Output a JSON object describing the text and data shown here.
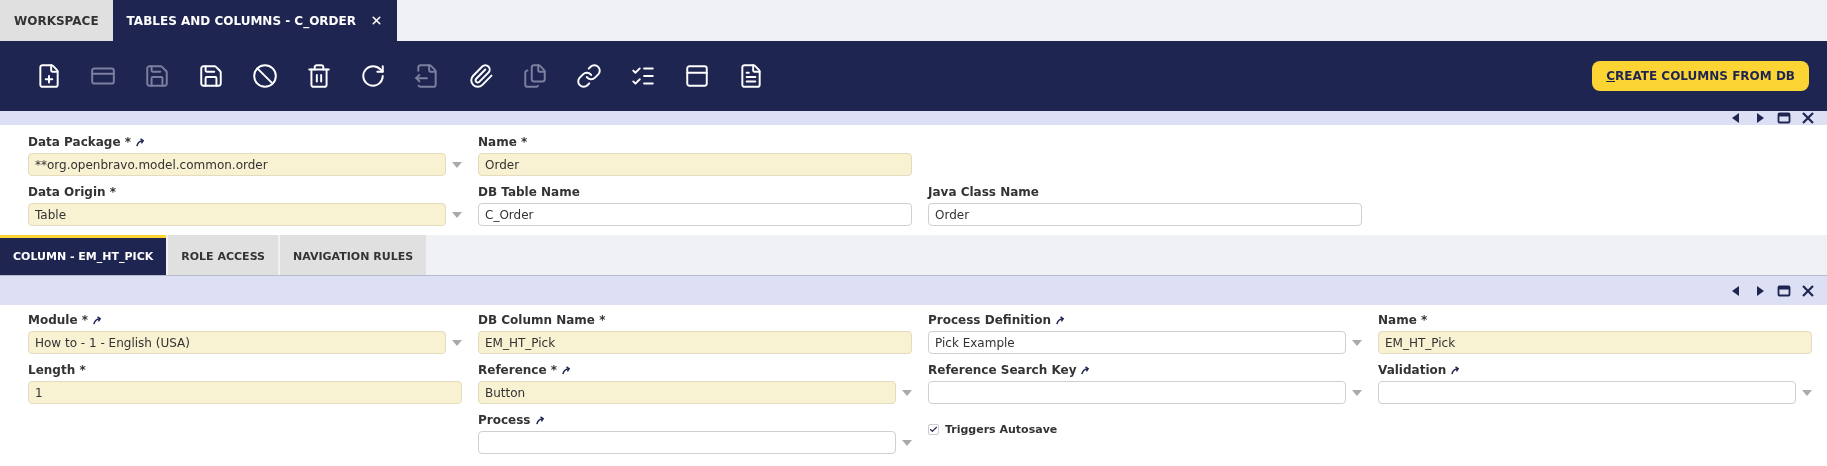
{
  "tabs": [
    {
      "label": "WORKSPACE",
      "selected": false,
      "closable": false
    },
    {
      "label": "TABLES AND COLUMNS - C_ORDER",
      "selected": true,
      "closable": true
    }
  ],
  "toolbar": {
    "buttons": [
      {
        "kind": "new-document",
        "disabled": false
      },
      {
        "kind": "new-row",
        "disabled": true
      },
      {
        "kind": "save",
        "disabled": true
      },
      {
        "kind": "save-close",
        "disabled": false
      },
      {
        "kind": "cancel",
        "disabled": false
      },
      {
        "kind": "delete",
        "disabled": false
      },
      {
        "kind": "refresh",
        "disabled": false
      },
      {
        "kind": "export",
        "disabled": true
      },
      {
        "kind": "attach",
        "disabled": false
      },
      {
        "kind": "copy",
        "disabled": true
      },
      {
        "kind": "link",
        "disabled": false
      },
      {
        "kind": "tools",
        "disabled": false
      },
      {
        "kind": "grid",
        "disabled": false
      },
      {
        "kind": "notes",
        "disabled": false
      }
    ],
    "action": "CREATE COLUMNS FROM DB"
  },
  "header_form": {
    "rows": [
      {
        "offset": false,
        "fields": [
          {
            "kind": "combo",
            "label": "Data Package *",
            "linked": true,
            "required": true,
            "value": "**org.openbravo.model.common.order"
          },
          {
            "kind": "text",
            "label": "Name *",
            "linked": false,
            "required": true,
            "value": "Order"
          }
        ]
      },
      {
        "offset": false,
        "fields": [
          {
            "kind": "combo",
            "label": "Data Origin *",
            "linked": false,
            "required": true,
            "value": "Table"
          },
          {
            "kind": "text",
            "label": "DB Table Name",
            "linked": false,
            "required": false,
            "value": "C_Order"
          },
          {
            "kind": "text",
            "label": "Java Class Name",
            "linked": false,
            "required": false,
            "value": "Order"
          }
        ]
      }
    ]
  },
  "subtabs": [
    {
      "label": "COLUMN - EM_HT_PICK",
      "selected": true
    },
    {
      "label": "ROLE ACCESS",
      "selected": false
    },
    {
      "label": "NAVIGATION RULES",
      "selected": false
    }
  ],
  "detail_form": {
    "rows": [
      {
        "offset": false,
        "fields": [
          {
            "kind": "combo",
            "label": "Module *",
            "linked": true,
            "required": true,
            "value": "How to - 1 - English (USA)"
          },
          {
            "kind": "text",
            "label": "DB Column Name *",
            "linked": false,
            "required": true,
            "value": "EM_HT_Pick"
          },
          {
            "kind": "combo",
            "label": "Process Definition",
            "linked": true,
            "required": false,
            "value": "Pick Example"
          },
          {
            "kind": "text",
            "label": "Name *",
            "linked": false,
            "required": true,
            "value": "EM_HT_Pick"
          }
        ]
      },
      {
        "offset": false,
        "fields": [
          {
            "kind": "text",
            "label": "Length *",
            "linked": false,
            "required": true,
            "value": "1"
          },
          {
            "kind": "combo",
            "label": "Reference *",
            "linked": true,
            "required": true,
            "value": "Button"
          },
          {
            "kind": "combo",
            "label": "Reference Search Key",
            "linked": true,
            "required": false
          },
          {
            "kind": "combo",
            "label": "Validation",
            "linked": true,
            "required": false
          }
        ]
      },
      {
        "offset": true,
        "fields": [
          {
            "kind": "combo",
            "label": "Process",
            "linked": true,
            "required": false
          },
          {
            "kind": "checkbox",
            "label": "Triggers Autosave",
            "checked": true
          }
        ]
      }
    ]
  }
}
